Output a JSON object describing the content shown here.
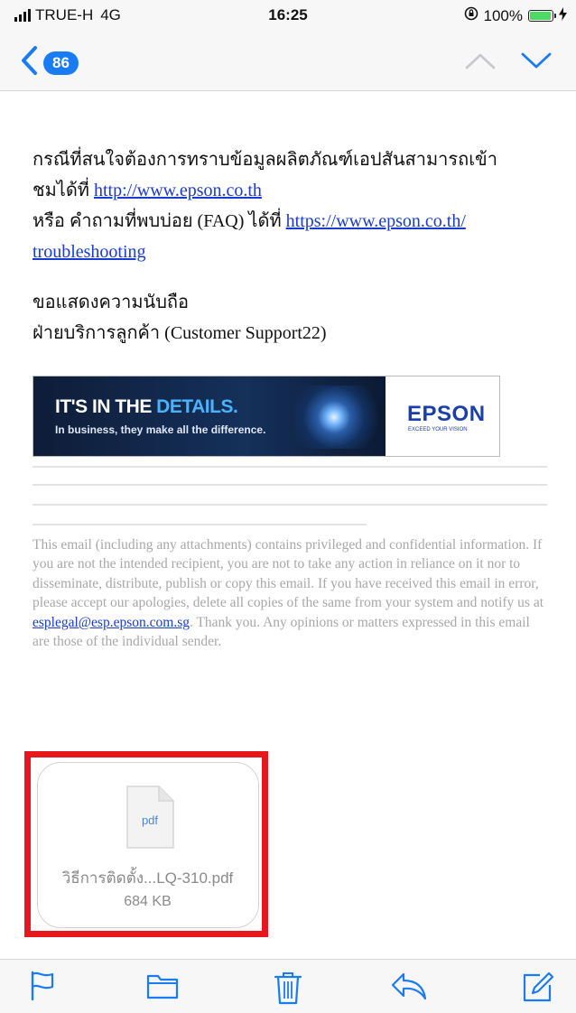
{
  "status_bar": {
    "carrier": "TRUE-H",
    "network": "4G",
    "time": "16:25",
    "battery": "100%",
    "battery_level": 1.0,
    "icons": [
      "signal-icon",
      "orientation-lock-icon",
      "battery-icon",
      "charging-icon"
    ]
  },
  "nav": {
    "back_count": "86",
    "icons": [
      "back-chevron-icon",
      "previous-message-icon",
      "next-message-icon"
    ]
  },
  "email": {
    "line1": "กรณีที่สนใจต้องการทราบข้อมูลผลิตภัณฑ์เอปสันสามารถเข้า",
    "line2_prefix": "ชมได้ที่ ",
    "website_link": "http://www.epson.co.th",
    "line3_prefix": "หรือ คำถามที่พบบ่อย (FAQ) ได้ที่ ",
    "faq_link": "https://www.epson.co.th/troubleshooting",
    "faq_link_line1": "https://www.epson.co.th/",
    "faq_link_line2": "troubleshooting",
    "closing": "ขอแสดงความนับถือ",
    "signature": "ฝ่ายบริการลูกค้า (Customer Support22)"
  },
  "banner": {
    "headline_prefix": "IT'S IN THE ",
    "headline_highlight": "DETAILS.",
    "subline": "In business, they make all the difference.",
    "brand": "EPSON",
    "brand_tagline": "EXCEED YOUR VISION"
  },
  "disclaimer": {
    "text_before": "This email (including any attachments) contains privileged and confidential information. If you are not the intended recipient, you are not to take any action in reliance on it nor to disseminate, distribute, publish or copy this email. If you have received this email in error, please accept our apologies, delete all copies of the same from your system and notify us at ",
    "email_link": "esplegal@esp.epson.com.sg",
    "text_after": ". Thank you. Any opinions or matters expressed in this email are those of the individual sender."
  },
  "attachment": {
    "type_label": "pdf",
    "file_name": "วิธีการติดตั้ง...LQ-310.pdf",
    "file_size": "684 KB",
    "highlight_color": "#e8171b"
  },
  "toolbar": {
    "icons": [
      "flag-icon",
      "folder-icon",
      "trash-icon",
      "reply-icon",
      "compose-icon"
    ]
  },
  "colors": {
    "accent": "#1a7cf5",
    "link": "#1a3bd0",
    "bar_background": "#f7f7f7",
    "disclaimer_text": "#a8a8a8"
  }
}
